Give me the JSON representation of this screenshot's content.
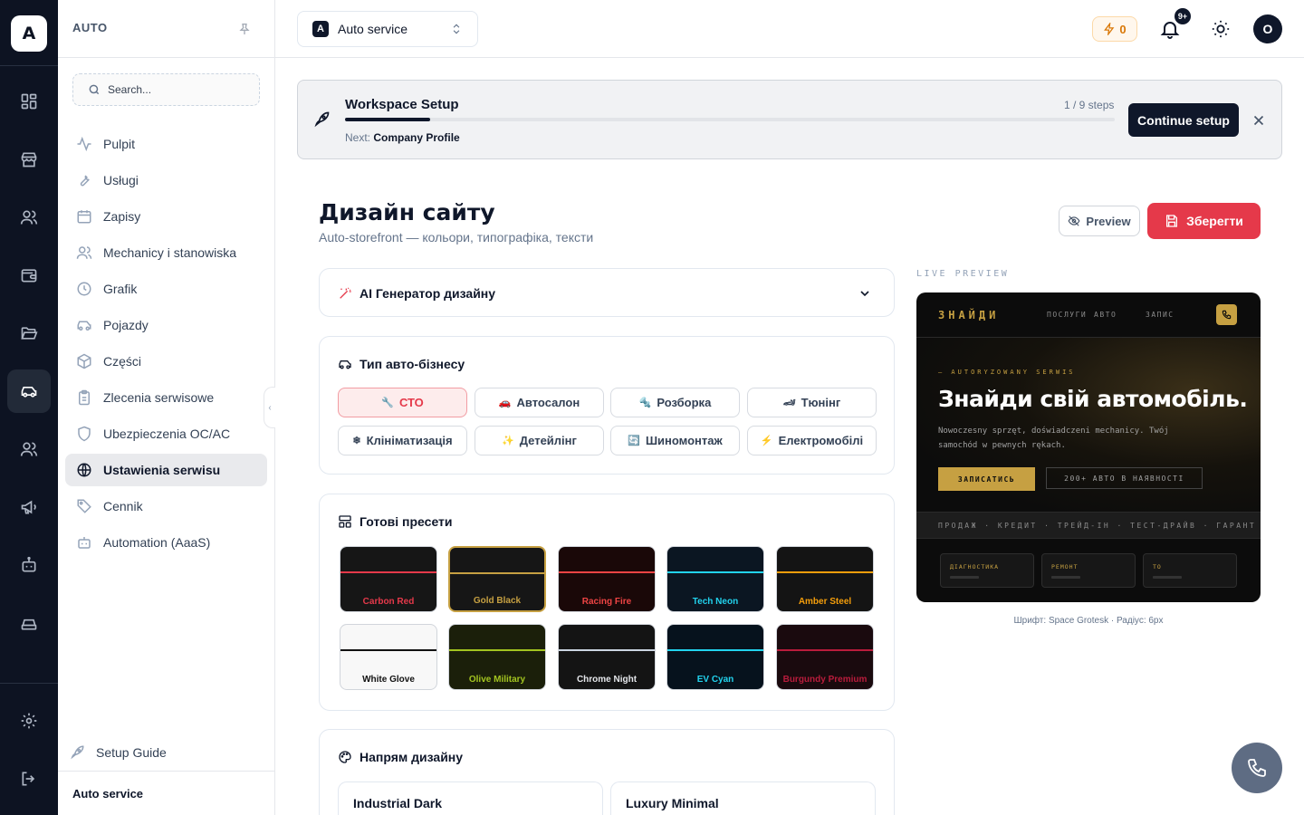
{
  "rail": {
    "logo": "A",
    "items": [
      "grid-icon",
      "store-icon",
      "users-icon",
      "wallet-icon",
      "folder-icon",
      "car-icon",
      "team-icon",
      "megaphone-icon",
      "bot-icon",
      "vehicle-icon"
    ],
    "active_item": "car-icon"
  },
  "sidebar": {
    "title": "AUTO",
    "search_placeholder": "Search...",
    "items": [
      {
        "label": "Pulpit",
        "icon": "activity-icon"
      },
      {
        "label": "Usługi",
        "icon": "wrench-icon"
      },
      {
        "label": "Zapisy",
        "icon": "calendar-icon"
      },
      {
        "label": "Mechanicy i stanowiska",
        "icon": "users-icon"
      },
      {
        "label": "Grafik",
        "icon": "clock-icon"
      },
      {
        "label": "Pojazdy",
        "icon": "car-icon"
      },
      {
        "label": "Części",
        "icon": "box-icon"
      },
      {
        "label": "Zlecenia serwisowe",
        "icon": "clipboard-icon"
      },
      {
        "label": "Ubezpieczenia OC/AC",
        "icon": "shield-icon"
      },
      {
        "label": "Ustawienia serwisu",
        "icon": "globe-icon",
        "active": true
      },
      {
        "label": "Cennik",
        "icon": "tag-icon"
      },
      {
        "label": "Automation (AaaS)",
        "icon": "bot-icon"
      }
    ],
    "setup_guide": "Setup Guide",
    "footer": "Auto service"
  },
  "topbar": {
    "workspace_badge": "A",
    "workspace": "Auto service",
    "energy": "0",
    "notifications": "9+",
    "avatar": "O"
  },
  "setup": {
    "title": "Workspace Setup",
    "steps": "1 / 9 steps",
    "progress": 0.11,
    "next_label": "Next:",
    "next_value": "Company Profile",
    "button": "Continue setup"
  },
  "page": {
    "title": "Дизайн сайту",
    "subtitle": "Auto-storefront — кольори, типографіка, тексти",
    "preview_button": "Preview",
    "save_button": "Зберегти"
  },
  "ai_card": {
    "title": "AI Генератор дизайну"
  },
  "business": {
    "title": "Тип авто-бізнесу",
    "chips": [
      {
        "label": "СТО",
        "icon": "🔧",
        "active": true
      },
      {
        "label": "Автосалон",
        "icon": "🚗"
      },
      {
        "label": "Розборка",
        "icon": "🔩"
      },
      {
        "label": "Тюнінг",
        "icon": "🏎"
      },
      {
        "label": "Клініматизація",
        "icon": "❄"
      },
      {
        "label": "Детейлінг",
        "icon": "✨"
      },
      {
        "label": "Шиномонтаж",
        "icon": "🔄"
      },
      {
        "label": "Електромобілі",
        "icon": "⚡"
      }
    ]
  },
  "presets": {
    "title": "Готові пресети",
    "items": [
      {
        "name": "Carbon Red",
        "bg": "#161616",
        "accent": "#e5394a",
        "text": "#e5394a"
      },
      {
        "name": "Gold Black",
        "bg": "#161616",
        "accent": "#c6a042",
        "text": "#c6a042",
        "selected": true
      },
      {
        "name": "Racing Fire",
        "bg": "#1a0808",
        "accent": "#ef4444",
        "text": "#ef4444"
      },
      {
        "name": "Tech Neon",
        "bg": "#0b1622",
        "accent": "#22d3ee",
        "text": "#22d3ee"
      },
      {
        "name": "Amber Steel",
        "bg": "#141414",
        "accent": "#f59e0b",
        "text": "#f59e0b"
      },
      {
        "name": "White Glove",
        "bg": "#f8f8f8",
        "accent": "#111111",
        "text": "#111111"
      },
      {
        "name": "Olive Military",
        "bg": "#1b1f0a",
        "accent": "#a3c420",
        "text": "#a3c420"
      },
      {
        "name": "Chrome Night",
        "bg": "#141414",
        "accent": "#cbd5e1",
        "text": "#e5e7eb"
      },
      {
        "name": "EV Cyan",
        "bg": "#06121d",
        "accent": "#22d3ee",
        "text": "#22d3ee"
      },
      {
        "name": "Burgundy Premium",
        "bg": "#1a0a0e",
        "accent": "#b91c3c",
        "text": "#b91c3c"
      }
    ]
  },
  "direction": {
    "title": "Напрям дизайну",
    "options": [
      "Industrial Dark",
      "Luxury Minimal"
    ]
  },
  "live_preview": {
    "label": "LIVE PREVIEW",
    "logo": "ЗНАЙДИ",
    "nav": [
      "ПОСЛУГИ",
      "АВТО",
      "ЗАПИС"
    ],
    "kicker": "— AUTORYZOWANY SERWIS",
    "headline": "Знайди свій автомобіль.",
    "paragraph": "Nowoczesny sprzęt, doświadczeni mechanicy. Twój samochód w pewnych rękach.",
    "cta_primary": "ЗАПИСАТИСЬ",
    "cta_secondary": "200+ АВТО В НАЯВНОСТІ",
    "ticker": "ПРОДАЖ · КРЕДИТ · ТРЕЙД-ІН · ТЕСТ-ДРАЙВ · ГАРАНТ",
    "services": [
      "ДІАГНОСТИКА",
      "РЕМОНТ",
      "ТО"
    ],
    "font_note": "Шрифт: Space Grotesk · Радіус: 6px",
    "accent": "#c6a042"
  }
}
